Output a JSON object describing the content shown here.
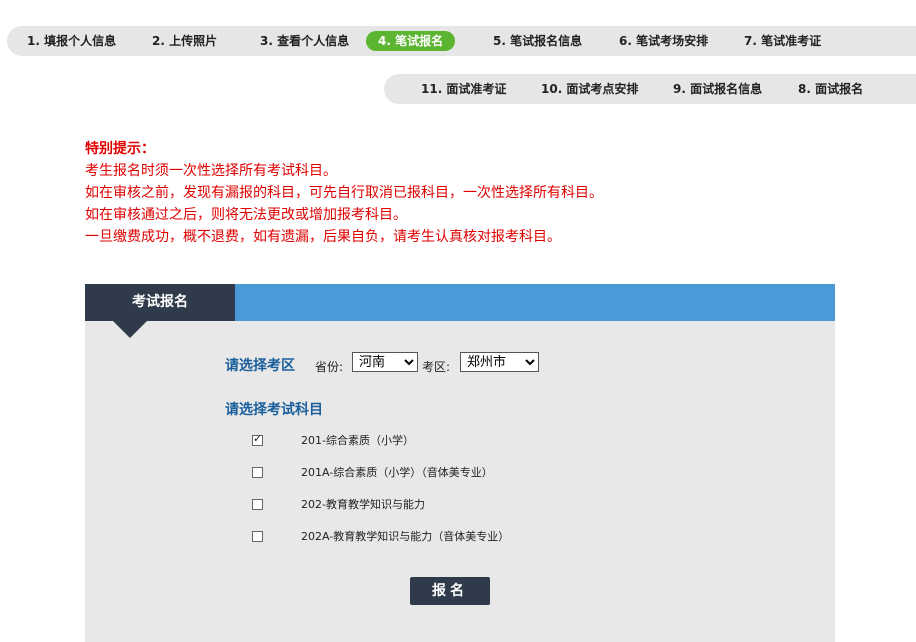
{
  "steps_row1": [
    {
      "label": "1. 填报个人信息",
      "active": false
    },
    {
      "label": "2. 上传照片",
      "active": false
    },
    {
      "label": "3. 查看个人信息",
      "active": false
    },
    {
      "label": "4. 笔试报名",
      "active": true
    },
    {
      "label": "5. 笔试报名信息",
      "active": false
    },
    {
      "label": "6. 笔试考场安排",
      "active": false
    },
    {
      "label": "7. 笔试准考证",
      "active": false
    }
  ],
  "steps_row2": [
    {
      "label": "11. 面试准考证"
    },
    {
      "label": "10. 面试考点安排"
    },
    {
      "label": "9. 面试报名信息"
    },
    {
      "label": "8. 面试报名"
    }
  ],
  "notice": {
    "title": "特别提示：",
    "lines": [
      "考生报名时须一次性选择所有考试科目。",
      "如在审核之前，发现有漏报的科目，可先自行取消已报科目，一次性选择所有科目。",
      "如在审核通过之后，则将无法更改或增加报考科目。",
      "一旦缴费成功，概不退费，如有遗漏，后果自负，请考生认真核对报考科目。"
    ]
  },
  "panel": {
    "tab_title": "考试报名",
    "region_label": "请选择考区",
    "province_label": "省份:",
    "province_value": "河南",
    "district_label": "考区:",
    "district_value": "郑州市",
    "subjects_label": "请选择考试科目",
    "subjects": [
      {
        "label": "201-综合素质（小学）",
        "checked": true
      },
      {
        "label": "201A-综合素质（小学）（音体美专业）",
        "checked": false
      },
      {
        "label": "202-教育教学知识与能力",
        "checked": false
      },
      {
        "label": "202A-教育教学知识与能力（音体美专业）",
        "checked": false
      }
    ],
    "submit_label": "报名"
  },
  "colors": {
    "active_step": "#5cb531",
    "panel_header": "#4a9ad8",
    "dark_tab": "#2f3a4a",
    "notice_text": "#e00000",
    "section_label": "#1a5f9c"
  }
}
